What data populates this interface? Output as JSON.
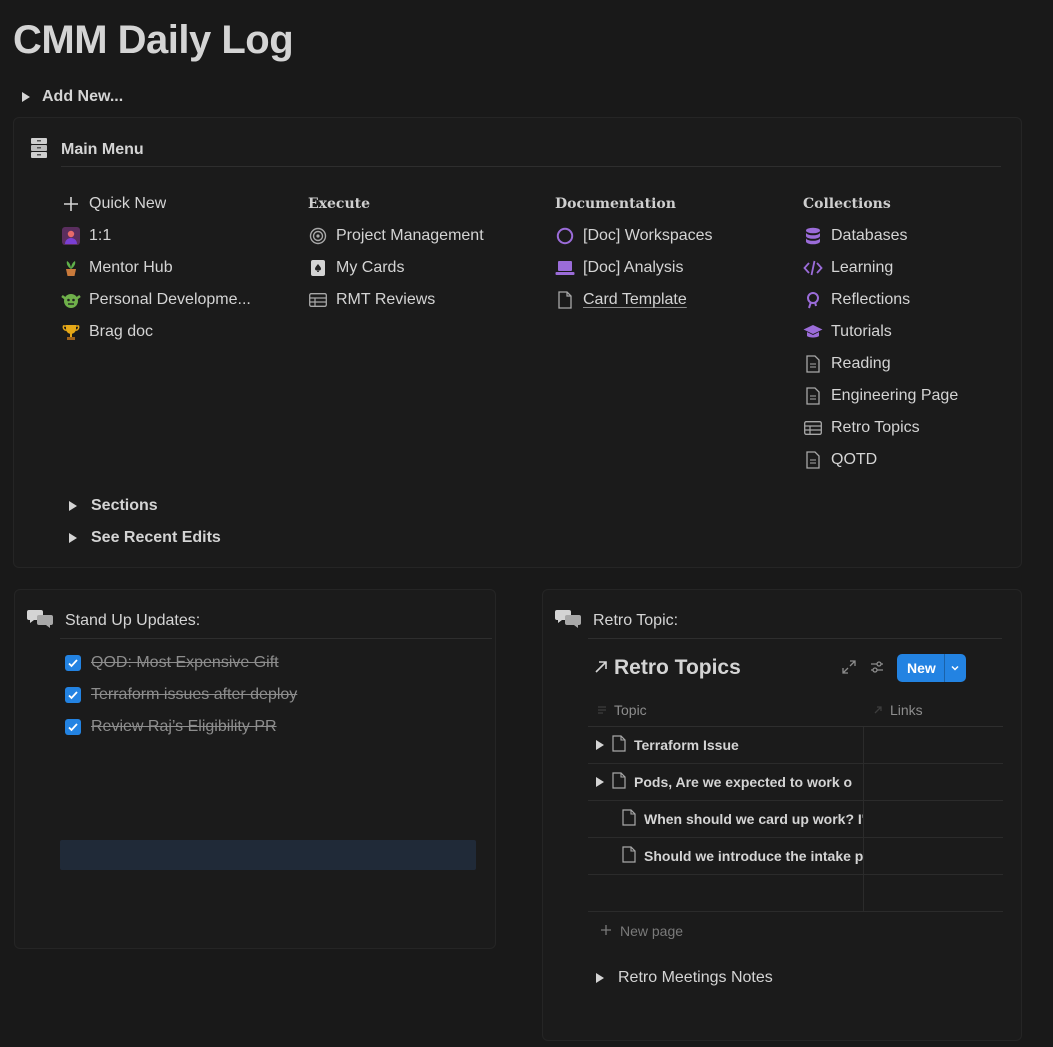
{
  "page": {
    "title": "CMM Daily Log"
  },
  "add_new": {
    "label": "Add New..."
  },
  "main_menu": {
    "title": "Main Menu",
    "col1": [
      {
        "label": "Quick New",
        "icon": "plus-icon"
      },
      {
        "label": "1:1",
        "icon": "person-icon"
      },
      {
        "label": "Mentor Hub",
        "icon": "potted-plant-icon"
      },
      {
        "label": "Personal Developme...",
        "icon": "goblin-icon"
      },
      {
        "label": "Brag doc",
        "icon": "trophy-icon"
      }
    ],
    "col2": {
      "heading": "Execute",
      "items": [
        {
          "label": "Project Management",
          "icon": "target-icon"
        },
        {
          "label": "My Cards",
          "icon": "card-icon"
        },
        {
          "label": "RMT Reviews",
          "icon": "table-icon"
        }
      ]
    },
    "col3": {
      "heading": "Documentation",
      "items": [
        {
          "label": "[Doc] Workspaces",
          "icon": "circle-icon"
        },
        {
          "label": "[Doc] Analysis",
          "icon": "laptop-icon"
        },
        {
          "label": "Card Template",
          "icon": "page-icon"
        }
      ]
    },
    "col4": {
      "heading": "Collections",
      "items": [
        {
          "label": "Databases",
          "icon": "database-icon"
        },
        {
          "label": "Learning",
          "icon": "code-icon"
        },
        {
          "label": "Reflections",
          "icon": "thinking-icon"
        },
        {
          "label": "Tutorials",
          "icon": "graduation-cap-icon"
        },
        {
          "label": "Reading",
          "icon": "page-icon"
        },
        {
          "label": "Engineering Page",
          "icon": "page-icon"
        },
        {
          "label": "Retro Topics",
          "icon": "table-icon"
        },
        {
          "label": "QOTD",
          "icon": "page-icon"
        }
      ]
    },
    "sections_label": "Sections",
    "recent_edits_label": "See Recent Edits"
  },
  "standup": {
    "title": "Stand Up Updates:",
    "todos": [
      {
        "label": "QOD:  Most Expensive Gift ",
        "checked": true
      },
      {
        "label": "Terraform issues after deploy",
        "checked": true
      },
      {
        "label": "Review Raj’s Eligibility PR",
        "checked": true
      }
    ]
  },
  "retro": {
    "title": "Retro Topic:",
    "db_title": "Retro Topics",
    "new_button": "New",
    "columns": {
      "topic": "Topic",
      "links": "Links"
    },
    "rows": [
      {
        "topic": "Terraform Issue",
        "expandable": true
      },
      {
        "topic": "Pods, Are we expected to work o",
        "expandable": true
      },
      {
        "topic": "When should we card up work? I'",
        "expandable": false
      },
      {
        "topic": "Should we introduce the intake p",
        "expandable": false
      }
    ],
    "new_page": "New page",
    "meetings_toggle": "Retro Meetings Notes"
  },
  "colors": {
    "accent": "#2383e2",
    "background": "#191919",
    "purple": "#9b6cd9"
  }
}
